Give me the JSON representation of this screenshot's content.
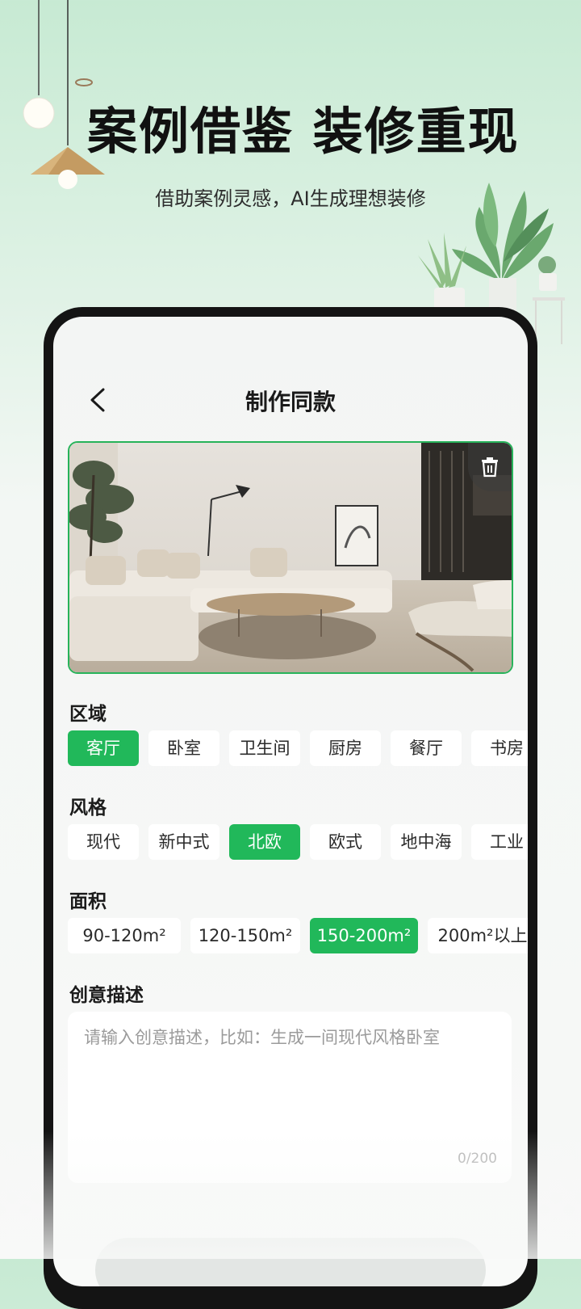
{
  "hero": {
    "title": "案例借鉴 装修重现",
    "subtitle": "借助案例灵感，AI生成理想装修"
  },
  "header": {
    "back_icon": "chevron-left-icon",
    "title": "制作同款"
  },
  "photo": {
    "description": "living room interior photo",
    "delete_icon": "trash-icon"
  },
  "region": {
    "label": "区域",
    "options": [
      "客厅",
      "卧室",
      "卫生间",
      "厨房",
      "餐厅",
      "书房"
    ],
    "selected": "客厅"
  },
  "style": {
    "label": "风格",
    "options": [
      "现代",
      "新中式",
      "北欧",
      "欧式",
      "地中海",
      "工业"
    ],
    "selected": "北欧"
  },
  "area": {
    "label": "面积",
    "options": [
      "90-120m²",
      "120-150m²",
      "150-200m²",
      "200m²以上"
    ],
    "selected": "150-200m²"
  },
  "description": {
    "label": "创意描述",
    "placeholder": "请输入创意描述，比如：生成一间现代风格卧室",
    "value": "",
    "counter": "0/200"
  },
  "colors": {
    "accent": "#21b85a",
    "chip_bg": "#ffffff",
    "phone_frame": "#141414"
  }
}
